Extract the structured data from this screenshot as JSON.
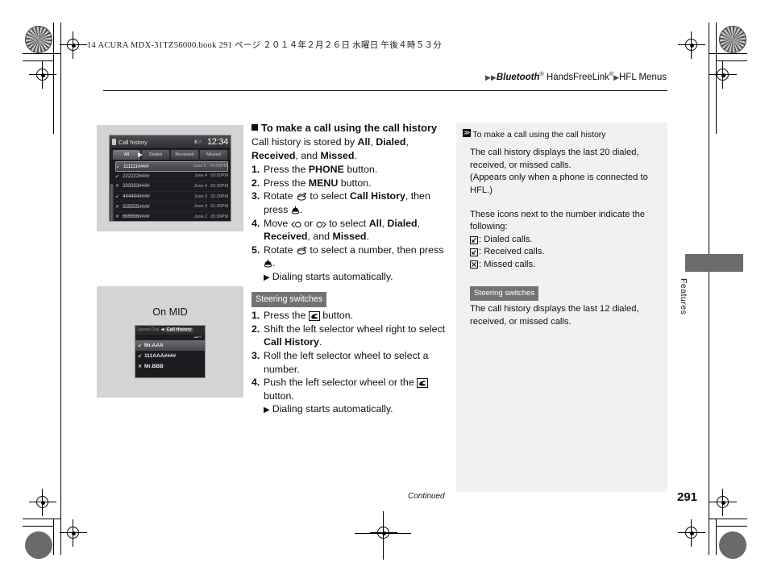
{
  "print": {
    "book_line": "14 ACURA MDX-31TZ56000.book  291 ページ  ２０１４年２月２６日  水曜日  午後４時５３分"
  },
  "header": {
    "breadcrumb_tri1": "▶",
    "breadcrumb_tri2": "▶",
    "breadcrumb_bluetooth": "Bluetooth",
    "breadcrumb_hfl": " HandsFreeLink",
    "breadcrumb_tri3": "▶",
    "breadcrumb_menus": "HFL Menus",
    "reg_mark": "®"
  },
  "figures": {
    "nav_screen": {
      "title": "Call history",
      "signal": "",
      "clock": "12:34",
      "tabs": [
        {
          "label": "All",
          "active": true
        },
        {
          "label": "Dialed",
          "active": false
        },
        {
          "label": "Received",
          "active": false
        },
        {
          "label": "Missed",
          "active": false
        }
      ],
      "rows": [
        {
          "icon": "dialed",
          "number": "111111####",
          "date": "June 5",
          "time": "04:55PM",
          "selected": true
        },
        {
          "icon": "dialed",
          "number": "222222####",
          "date": "June 4",
          "time": "09:50PM",
          "selected": false
        },
        {
          "icon": "missed",
          "number": "333333####",
          "date": "June 4",
          "time": "03:30PM",
          "selected": false
        },
        {
          "icon": "dialed",
          "number": "444444####",
          "date": "June 3",
          "time": "02:20PM",
          "selected": false
        },
        {
          "icon": "missed",
          "number": "555555####",
          "date": "June 3",
          "time": "01:30PM",
          "selected": false
        },
        {
          "icon": "missed",
          "number": "666666####",
          "date": "June 2",
          "time": "05:00PM",
          "selected": false
        }
      ]
    },
    "mid_screen": {
      "caption": "On MID",
      "tab_inactive": "Speed Dial",
      "caret": "◀",
      "tab_active": "Call History",
      "rows": [
        {
          "icon": "dialed",
          "label": "Mr.AAA",
          "selected": true
        },
        {
          "icon": "dialed",
          "label": "111AAA####",
          "selected": false
        },
        {
          "icon": "missed",
          "label": "Mr.BBB",
          "selected": false
        }
      ]
    }
  },
  "main": {
    "heading": "To make a call using the call history",
    "intro": [
      {
        "t": "Call history is stored by "
      },
      {
        "t": "All",
        "b": true
      },
      {
        "t": ", "
      },
      {
        "t": "Dialed",
        "b": true
      },
      {
        "t": ", "
      },
      {
        "t": "Received",
        "b": true
      },
      {
        "t": ", and "
      },
      {
        "t": "Missed",
        "b": true
      },
      {
        "t": "."
      }
    ],
    "steps": [
      {
        "n": "1.",
        "html": "Press the <b>PHONE</b> button."
      },
      {
        "n": "2.",
        "html": "Press the <b>MENU</b> button."
      },
      {
        "n": "3.",
        "html": "Rotate <i class=\"ico-rotate\"></i> to select <b>Call History</b>, then press <i class=\"ico-enter\"></i>."
      },
      {
        "n": "4.",
        "html": "Move <i class=\"ico-left\"></i> or <i class=\"ico-right\"></i> to select <b>All</b>, <b>Dialed</b>, <b>Received</b>, and <b>Missed</b>."
      },
      {
        "n": "5.",
        "html": "Rotate <i class=\"ico-rotate\"></i> to select a number, then press <i class=\"ico-enter\"></i>."
      }
    ],
    "result_1": "Dialing starts automatically.",
    "steering_tag": "Steering switches",
    "ss_steps": [
      {
        "n": "1.",
        "html": "Press the <i class=\"ico-hfl\"></i> button."
      },
      {
        "n": "2.",
        "html": "Shift the left selector wheel right to select <b>Call History</b>."
      },
      {
        "n": "3.",
        "html": "Roll the left selector wheel to select a number."
      },
      {
        "n": "4.",
        "html": "Push the left selector wheel or the <i class=\"ico-hfl\"></i> button."
      }
    ],
    "result_2": "Dialing starts automatically.",
    "arrow_glyph": "▶"
  },
  "sidebar": {
    "head_marker": "≫",
    "head": "To make a call using the call history",
    "para_1": "The call history displays the last 20 dialed, received, or missed calls.",
    "para_2": "(Appears only when a phone is connected to HFL.)",
    "para_3": "These icons next to the number indicate the following:",
    "icon_items": [
      {
        "icon": "dialed",
        "text": ": Dialed calls."
      },
      {
        "icon": "received",
        "text": ": Received calls."
      },
      {
        "icon": "missed",
        "text": ": Missed calls."
      }
    ],
    "steering_tag": "Steering switches",
    "para_4": "The call history displays the last 12 dialed, received, or missed calls."
  },
  "footer": {
    "continued": "Continued",
    "page_number": "291",
    "side_tab": "Features"
  },
  "colors": {
    "figure_bg": "#d4d4d4",
    "sidebar_bg": "#f1f1f1",
    "tag_bg": "#737373",
    "gray_bar": "#6b6b6b",
    "screen_bg": "#1c1d20"
  }
}
